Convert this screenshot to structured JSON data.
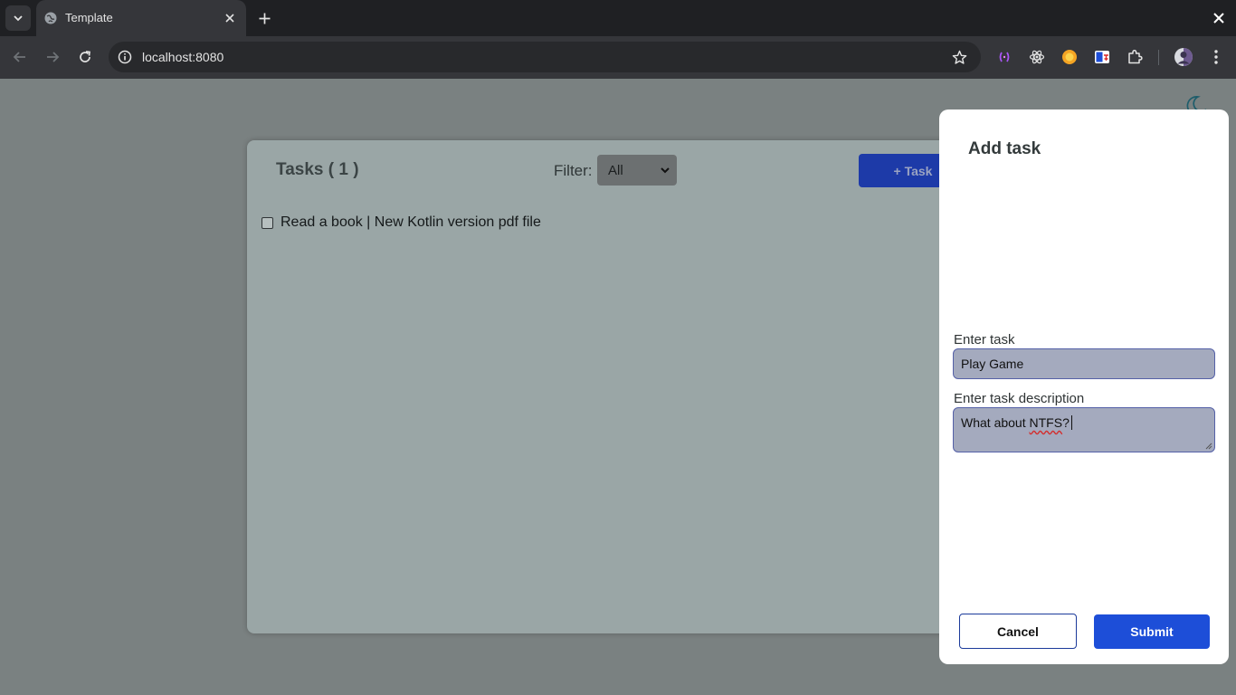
{
  "browser": {
    "tab_title": "Template",
    "url": "localhost:8080",
    "icons": {
      "tab_menu": "chevron-down-icon",
      "favicon": "globe-icon",
      "tab_close": "close-icon",
      "new_tab": "plus-icon",
      "window_close": "close-icon",
      "back": "arrow-left-icon",
      "forward": "arrow-right-icon",
      "reload": "reload-icon",
      "site_info": "info-icon",
      "bookmark": "star-icon",
      "extensions": [
        "code-extension-icon",
        "react-devtools-icon",
        "orange-extension-icon",
        "translate-extension-icon",
        "puzzle-icon"
      ],
      "profile": "avatar",
      "menu": "kebab-menu-icon"
    }
  },
  "page": {
    "theme_toggle_icon": "moon-icon",
    "tasks": {
      "title": "Tasks ( 1 )",
      "filter_label": "Filter:",
      "filter_value": "All",
      "add_button": "+ Task",
      "items": [
        {
          "label": "Read a book | New Kotlin version pdf file",
          "checked": false
        }
      ]
    }
  },
  "modal": {
    "title": "Add task",
    "task_label": "Enter task",
    "task_value": "Play Game",
    "desc_label": "Enter task description",
    "desc_value_before": "What about ",
    "desc_value_misspelled": "NTFS",
    "desc_value_after": "?",
    "cancel_label": "Cancel",
    "submit_label": "Submit"
  },
  "colors": {
    "overlay": "#7a8181",
    "card": "#9aa6a6",
    "primary": "#1d4ed8",
    "input_bg": "#a4aabe"
  }
}
